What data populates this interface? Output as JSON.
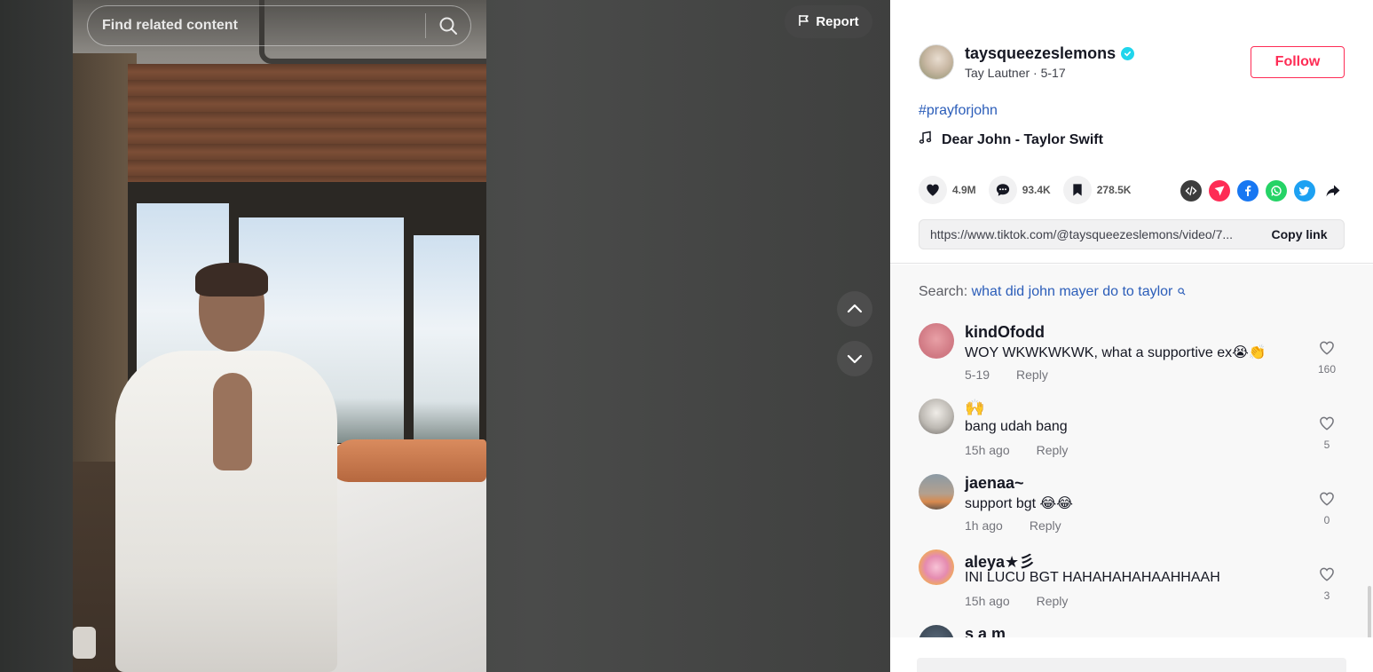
{
  "video": {
    "search_placeholder": "Find related content",
    "report_label": "Report"
  },
  "author": {
    "username": "taysqueezeslemons",
    "display_line": "Tay Lautner · 5-17",
    "verified": true,
    "follow_label": "Follow"
  },
  "post": {
    "hashtag": "#prayforjohn",
    "music": "Dear John - Taylor Swift"
  },
  "stats": {
    "likes": "4.9M",
    "comments": "93.4K",
    "saves": "278.5K"
  },
  "share": {
    "icons": [
      "embed-icon",
      "send-to-friends-icon",
      "facebook-icon",
      "whatsapp-icon",
      "twitter-icon",
      "share-arrow-icon"
    ],
    "colors": {
      "embed": "#3c3c3c",
      "send": "#fe2c55",
      "facebook": "#1877f2",
      "whatsapp": "#25d366",
      "twitter": "#1da1f2"
    }
  },
  "link": {
    "url": "https://www.tiktok.com/@taysqueezeslemons/video/7...",
    "copy_label": "Copy link"
  },
  "search_suggestion": {
    "prefix": "Search:",
    "term": "what did john mayer do to taylor"
  },
  "comments": [
    {
      "user": "kindOfodd",
      "text": "WOY WKWKWKWK, what a supportive ex😭👏",
      "time": "5-19",
      "reply": "Reply",
      "likes": "160"
    },
    {
      "user": "🙌",
      "text": "bang udah bang",
      "time": "15h ago",
      "reply": "Reply",
      "likes": "5"
    },
    {
      "user": "jaenaa~",
      "text": "support bgt 😂😂",
      "time": "1h ago",
      "reply": "Reply",
      "likes": "0"
    },
    {
      "user": "aleya★彡",
      "text": "INI LUCU BGT HAHAHAHAHAAHHAAH",
      "time": "15h ago",
      "reply": "Reply",
      "likes": "3"
    },
    {
      "user": "s a m",
      "text": "",
      "time": "",
      "reply": "",
      "likes": ""
    }
  ],
  "colors": {
    "accent": "#fe2c55",
    "link_blue": "#2b5db9",
    "verified": "#20d5ec"
  }
}
